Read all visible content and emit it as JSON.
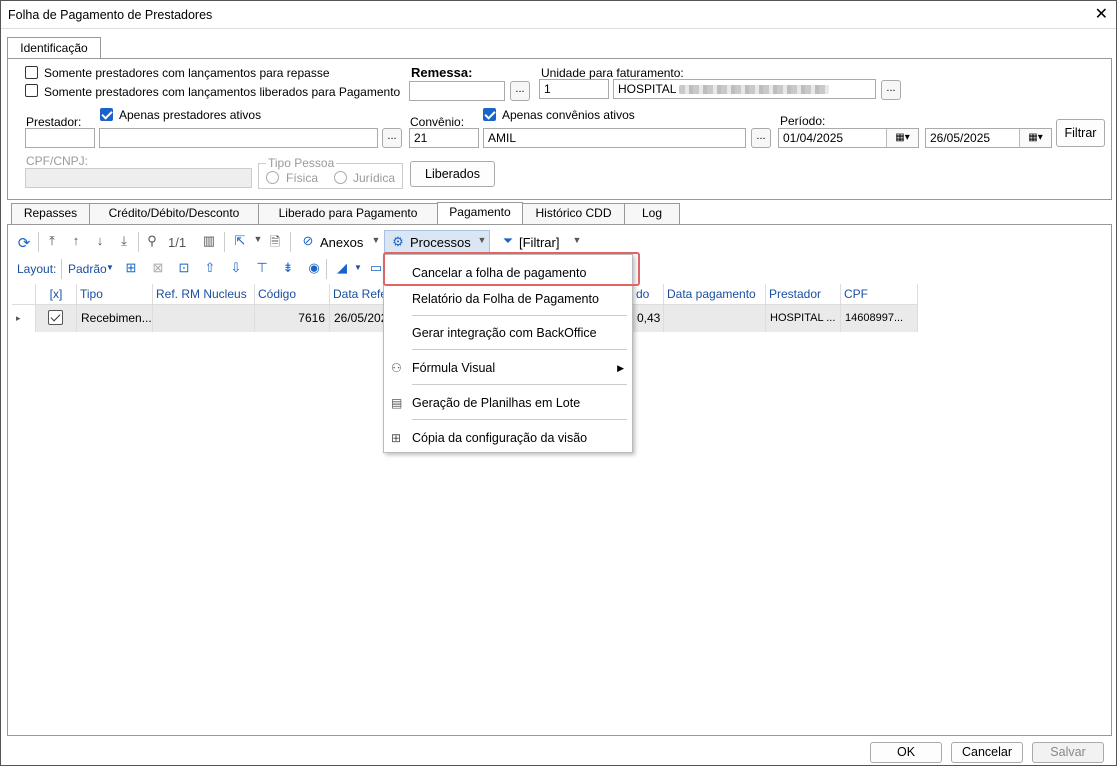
{
  "window": {
    "title": "Folha de Pagamento de Prestadores",
    "close_glyph": "✕"
  },
  "top_tab": {
    "label": "Identificação"
  },
  "ident": {
    "chk_repasse": "Somente prestadores com lançamentos para repasse",
    "chk_liberados": "Somente prestadores com lançamentos liberados para Pagamento",
    "remessa_label": "Remessa:",
    "unidade_label": "Unidade para faturamento:",
    "unidade_code": "1",
    "unidade_name": "HOSPITAL",
    "prestador_label": "Prestador:",
    "apenas_prestadores": "Apenas prestadores ativos",
    "convenio_label": "Convênio:",
    "apenas_convenios": "Apenas convênios ativos",
    "convenio_code": "21",
    "convenio_name": "AMIL",
    "periodo_label": "Período:",
    "data_inicio": "01/04/2025",
    "data_fim": "26/05/2025",
    "filtrar": "Filtrar",
    "cpf_label": "CPF/CNPJ:",
    "tipo_pessoa_label": "Tipo Pessoa",
    "fisica": "Física",
    "juridica": "Jurídica",
    "liberados": "Liberados",
    "ellipsis": "..."
  },
  "tabs": [
    "Repasses",
    "Crédito/Débito/Desconto",
    "Liberado para Pagamento",
    "Pagamento",
    "Histórico CDD",
    "Log"
  ],
  "toolbar": {
    "page": "1/1",
    "anexos": "Anexos",
    "processos": "Processos",
    "filtrar": "[Filtrar]",
    "layout_label": "Layout:",
    "layout_value": "Padrão"
  },
  "grid": {
    "headers": [
      "[x]",
      "Tipo",
      "Ref. RM Nucleus",
      "Código",
      "Data Refer",
      "do",
      "Data pagamento",
      "Prestador",
      "CPF"
    ],
    "row": {
      "tipo": "Recebimen...",
      "ref": "",
      "codigo": "7616",
      "data_ref": "26/05/202",
      "valor": "0,43",
      "data_pag": "",
      "prestador": "HOSPITAL ...",
      "cpf": "14608997..."
    }
  },
  "menu": {
    "items": [
      "Cancelar a folha de pagamento",
      "Relatório da Folha de Pagamento",
      "Gerar integração com BackOffice",
      "Fórmula Visual",
      "Geração de Planilhas em Lote",
      "Cópia da configuração da visão"
    ]
  },
  "footer": {
    "ok": "OK",
    "cancelar": "Cancelar",
    "salvar": "Salvar"
  }
}
